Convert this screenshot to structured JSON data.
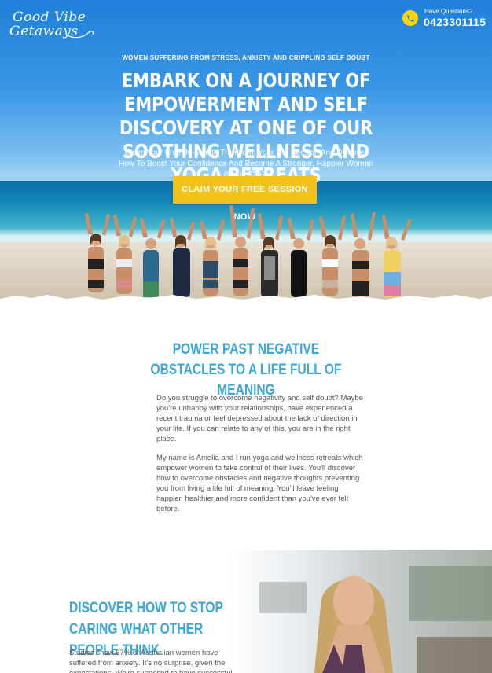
{
  "header": {
    "logo_line1": "Good Vibe",
    "logo_line2": "Getaways",
    "contact_label": "Have Questions?",
    "phone": "0423301115"
  },
  "hero": {
    "eyebrow": "WOMEN SUFFERING FROM STRESS, ANXIETY AND CRIPPLING SELF DOUBT",
    "headline": "EMBARK ON A JOURNEY OF EMPOWERMENT AND SELF DISCOVERY AT ONE OF OUR SOOTHING WELLNESS AND YOGA RETREATS",
    "subhead": "Claim Your Free 30-Minute Transform Your Life Session And Discover How To Boost Your Confidence And Become A Stronger, Happier Woman (Value $297)",
    "cta_label": "CLAIM YOUR FREE SESSION NOW"
  },
  "section_obstacles": {
    "title": "POWER PAST NEGATIVE OBSTACLES TO A LIFE FULL OF MEANING",
    "paragraph1": "Do you struggle to overcome negativity and self doubt? Maybe you're unhappy with your relationships, have experienced a recent trauma or feel depressed about the lack of direction in your life. If you can relate to any of this, you are in the right place.",
    "paragraph2": "My name is Amelia and I run yoga and wellness  retreats which empower women to take control of their lives. You'll discover how to overcome obstacles and negative thoughts preventing you from living a life full of meaning. You'll leave feeling happier, healthier and more confident than you've ever felt before."
  },
  "section_caring": {
    "title": "DISCOVER HOW TO STOP CARING WHAT OTHER PEOPLE THINK",
    "paragraph": "Studies show 67% of Australian women have suffered from anxiety. It's no surprise, given the expectations. We're supposed to have successful careers, maintain"
  },
  "colors": {
    "accent_blue": "#3aa7d8",
    "cta_yellow": "#f2c21a",
    "text_gray": "#555555"
  },
  "icons": {
    "phone": "phone-icon"
  }
}
